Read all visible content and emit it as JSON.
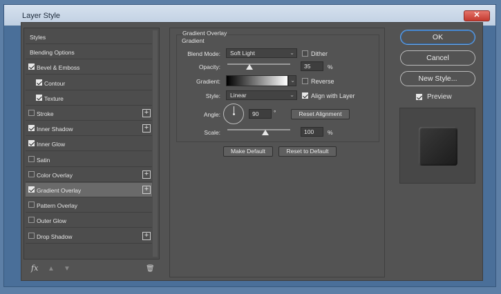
{
  "window": {
    "title": "Layer Style",
    "close_label": "✕"
  },
  "styles_list": [
    {
      "label": "Styles",
      "checkbox": false,
      "checked": false,
      "plus": false,
      "selected": false
    },
    {
      "label": "Blending Options",
      "checkbox": false,
      "checked": false,
      "plus": false,
      "selected": false
    },
    {
      "label": "Bevel & Emboss",
      "checkbox": true,
      "checked": true,
      "plus": false,
      "selected": false
    },
    {
      "label": "Contour",
      "checkbox": true,
      "checked": true,
      "plus": false,
      "selected": false,
      "indent": true
    },
    {
      "label": "Texture",
      "checkbox": true,
      "checked": true,
      "plus": false,
      "selected": false,
      "indent": true
    },
    {
      "label": "Stroke",
      "checkbox": true,
      "checked": false,
      "plus": true,
      "selected": false
    },
    {
      "label": "Inner Shadow",
      "checkbox": true,
      "checked": true,
      "plus": true,
      "selected": false
    },
    {
      "label": "Inner Glow",
      "checkbox": true,
      "checked": true,
      "plus": false,
      "selected": false
    },
    {
      "label": "Satin",
      "checkbox": true,
      "checked": false,
      "plus": false,
      "selected": false
    },
    {
      "label": "Color Overlay",
      "checkbox": true,
      "checked": false,
      "plus": true,
      "selected": false
    },
    {
      "label": "Gradient Overlay",
      "checkbox": true,
      "checked": true,
      "plus": true,
      "selected": true
    },
    {
      "label": "Pattern Overlay",
      "checkbox": true,
      "checked": false,
      "plus": false,
      "selected": false
    },
    {
      "label": "Outer Glow",
      "checkbox": true,
      "checked": false,
      "plus": false,
      "selected": false
    },
    {
      "label": "Drop Shadow",
      "checkbox": true,
      "checked": false,
      "plus": true,
      "selected": false
    }
  ],
  "panel_tools": {
    "fx": "fx",
    "up": "▲",
    "down": "▼",
    "trash": "🗑"
  },
  "gradient_overlay": {
    "group_title": "Gradient Overlay",
    "sub_title": "Gradient",
    "blend_mode_label": "Blend Mode:",
    "blend_mode_value": "Soft Light",
    "dither_label": "Dither",
    "dither_checked": false,
    "opacity_label": "Opacity:",
    "opacity_value": "35",
    "opacity_unit": "%",
    "opacity_fraction": 0.35,
    "gradient_label": "Gradient:",
    "reverse_label": "Reverse",
    "reverse_checked": false,
    "style_label": "Style:",
    "style_value": "Linear",
    "align_label": "Align with Layer",
    "align_checked": true,
    "angle_label": "Angle:",
    "angle_value": "90",
    "angle_unit": "°",
    "reset_alignment_label": "Reset Alignment",
    "scale_label": "Scale:",
    "scale_value": "100",
    "scale_unit": "%",
    "make_default_label": "Make Default",
    "reset_default_label": "Reset to Default"
  },
  "actions": {
    "ok_label": "OK",
    "cancel_label": "Cancel",
    "new_style_label": "New Style...",
    "preview_label": "Preview",
    "preview_checked": true
  },
  "colors": {
    "dialog_bg": "#535353",
    "selected_row": "#6a6a6a",
    "accent": "#2f6fb6"
  }
}
